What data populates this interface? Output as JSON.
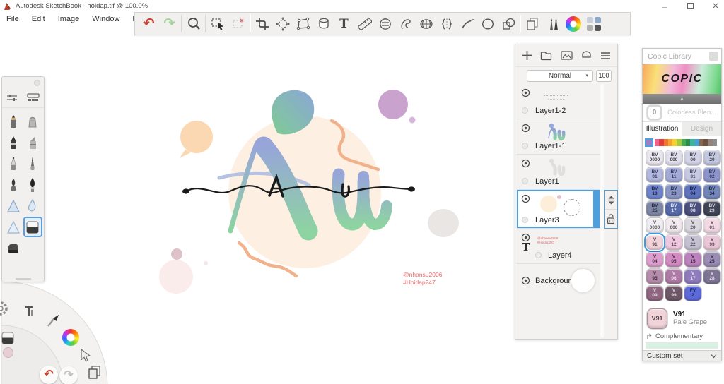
{
  "window": {
    "title": "Autodesk SketchBook - hoidap.tif @ 100.0%"
  },
  "menu": {
    "items": [
      "File",
      "Edit",
      "Image",
      "Window",
      "Help"
    ]
  },
  "toolbar": {
    "icons": [
      "undo",
      "redo",
      "zoom",
      "selection",
      "deselect",
      "crop",
      "transform",
      "distort",
      "fill",
      "text",
      "ruler",
      "ellipse-guide",
      "french-curve",
      "perspective",
      "symmetry",
      "steady-stroke",
      "ellipse",
      "shapes",
      "copy-layers",
      "brush-library",
      "color-wheel",
      "copic-swatches"
    ],
    "text_tool_glyph": "T"
  },
  "palette": {
    "tools": [
      "pencil",
      "crayon",
      "marker",
      "chisel-marker",
      "ballpoint-pen",
      "inking-pen",
      "brush-pen",
      "paint-brush",
      "airbrush",
      "smudge",
      "watercolor",
      "flood-fill",
      "eraser"
    ],
    "selected_tool": "flood-fill"
  },
  "canvas": {
    "credit_line1": "@nhansu2006",
    "credit_line2": "#Hoidap247"
  },
  "layers": {
    "blend_mode": "Normal",
    "opacity": "100",
    "selected": "Layer3",
    "items": [
      {
        "name": "Layer1-2"
      },
      {
        "name": "Layer1-1"
      },
      {
        "name": "Layer1"
      },
      {
        "name": "Layer3"
      },
      {
        "name": "Layer4"
      },
      {
        "name": "Background"
      }
    ]
  },
  "copic": {
    "title": "Copic Library",
    "logo": "COPIC",
    "blender_code": "0",
    "blender_name": "Colorless Blen...",
    "tabs": [
      {
        "label": "Illustration",
        "active": true
      },
      {
        "label": "Design",
        "active": false
      }
    ],
    "family_selected_color": "#9b7fc7",
    "family_colors": [
      "#f0628f",
      "#e23c3c",
      "#f0782e",
      "#f6a32f",
      "#f3d12f",
      "#a7c93e",
      "#46ad4e",
      "#2a8f4c",
      "#3cb4a0",
      "#49a0d8",
      "#8a674b",
      "#6b5340",
      "#93837a",
      "#8e8e8e"
    ],
    "markers": [
      {
        "p": "BV",
        "c": "0000",
        "bg": "#eae7f1",
        "fg": "#444444",
        "sel": false
      },
      {
        "p": "BV",
        "c": "000",
        "bg": "#e3e0ee",
        "fg": "#444444",
        "sel": false
      },
      {
        "p": "BV",
        "c": "00",
        "bg": "#d4d4e8",
        "fg": "#444444",
        "sel": false
      },
      {
        "p": "BV",
        "c": "20",
        "bg": "#c3c7de",
        "fg": "#3a3f55",
        "sel": false
      },
      {
        "p": "BV",
        "c": "01",
        "bg": "#b2b8dd",
        "fg": "#333a5c",
        "sel": false
      },
      {
        "p": "BV",
        "c": "11",
        "bg": "#a3aad6",
        "fg": "#333a5c",
        "sel": false
      },
      {
        "p": "BV",
        "c": "31",
        "bg": "#c7c9e3",
        "fg": "#44485e",
        "sel": false
      },
      {
        "p": "BV",
        "c": "02",
        "bg": "#8d95cc",
        "fg": "#2c3356",
        "sel": false
      },
      {
        "p": "BV",
        "c": "13",
        "bg": "#6f83c9",
        "fg": "#1d2547",
        "sel": false
      },
      {
        "p": "BV",
        "c": "23",
        "bg": "#8a96c4",
        "fg": "#20294a",
        "sel": false
      },
      {
        "p": "BV",
        "c": "04",
        "bg": "#5f74bd",
        "fg": "#15204a",
        "sel": false
      },
      {
        "p": "BV",
        "c": "34",
        "bg": "#7487b9",
        "fg": "#1c2545",
        "sel": false
      },
      {
        "p": "BV",
        "c": "25",
        "bg": "#7e87a6",
        "fg": "#232a3e",
        "sel": false
      },
      {
        "p": "BV",
        "c": "17",
        "bg": "#5668a8",
        "fg": "#e8ecf6",
        "sel": false
      },
      {
        "p": "BV",
        "c": "08",
        "bg": "#4a4f7c",
        "fg": "#dfe2f0",
        "sel": false
      },
      {
        "p": "BV",
        "c": "29",
        "bg": "#3f4354",
        "fg": "#d6d9e4",
        "sel": false
      },
      {
        "p": "V",
        "c": "0000",
        "bg": "#f0edf3",
        "fg": "#555555",
        "sel": false
      },
      {
        "p": "V",
        "c": "000",
        "bg": "#f3eaf0",
        "fg": "#555555",
        "sel": false
      },
      {
        "p": "V",
        "c": "20",
        "bg": "#dad7df",
        "fg": "#4a4a52",
        "sel": false
      },
      {
        "p": "V",
        "c": "01",
        "bg": "#f2d9e4",
        "fg": "#5c4450",
        "sel": false
      },
      {
        "p": "V",
        "c": "91",
        "bg": "#f1d3da",
        "fg": "#5c4450",
        "sel": true
      },
      {
        "p": "V",
        "c": "12",
        "bg": "#f0c9e0",
        "fg": "#5c4055",
        "sel": false
      },
      {
        "p": "V",
        "c": "22",
        "bg": "#c6c1d2",
        "fg": "#46425a",
        "sel": false
      },
      {
        "p": "V",
        "c": "93",
        "bg": "#eac6d8",
        "fg": "#5c4055",
        "sel": false
      },
      {
        "p": "V",
        "c": "04",
        "bg": "#dc9ecd",
        "fg": "#4e2a46",
        "sel": false
      },
      {
        "p": "V",
        "c": "05",
        "bg": "#d28cc2",
        "fg": "#4a2744",
        "sel": false
      },
      {
        "p": "V",
        "c": "15",
        "bg": "#bc82be",
        "fg": "#42243f",
        "sel": false
      },
      {
        "p": "V",
        "c": "25",
        "bg": "#9b8cb4",
        "fg": "#2e2640",
        "sel": false
      },
      {
        "p": "V",
        "c": "95",
        "bg": "#b58cab",
        "fg": "#3e2a3a",
        "sel": false
      },
      {
        "p": "V",
        "c": "06",
        "bg": "#ad7ba6",
        "fg": "#f0e4ee",
        "sel": false
      },
      {
        "p": "V",
        "c": "17",
        "bg": "#8e7cbc",
        "fg": "#ece6f4",
        "sel": false
      },
      {
        "p": "V",
        "c": "28",
        "bg": "#7d7494",
        "fg": "#e8e4f0",
        "sel": false
      },
      {
        "p": "V",
        "c": "09",
        "bg": "#8f6680",
        "fg": "#eedfe8",
        "sel": false
      },
      {
        "p": "V",
        "c": "99",
        "bg": "#6e5868",
        "fg": "#e4dae0",
        "sel": false
      },
      {
        "p": "FV",
        "c": "2",
        "bg": "#5d6ad9",
        "fg": "#101a50",
        "sel": false
      }
    ],
    "current": {
      "code": "V91",
      "name": "V91",
      "desc": "Pale Grape"
    },
    "complementary_label": "Complementary",
    "complement_bar_color": "#d7f2e3",
    "custom_set_label": "Custom set"
  }
}
